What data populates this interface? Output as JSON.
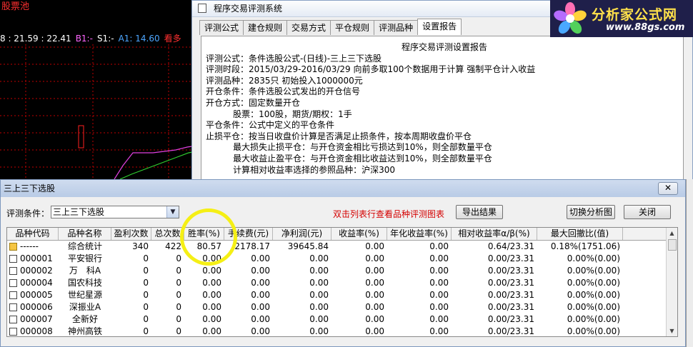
{
  "chart": {
    "title": "股票池",
    "legend": [
      {
        "text": "8 : 21.59 : 22.41",
        "color": "#ffffff"
      },
      {
        "text": "B1:-",
        "color": "#ff66ff"
      },
      {
        "text": "S1:-",
        "color": "#ffffff"
      },
      {
        "text": "A1: 14.60",
        "color": "#4da6ff"
      },
      {
        "text": "看多",
        "color": "#ff3030"
      }
    ],
    "colors": {
      "bg": "#000000",
      "magenta": "#e040e0",
      "green": "#30d030",
      "red": "#ff2020"
    }
  },
  "top_window": {
    "title": "程序交易评测系统",
    "tabs": [
      "评测公式",
      "建仓规则",
      "交易方式",
      "平仓规则",
      "评测品种",
      "设置报告"
    ],
    "active_tab": 5,
    "report": {
      "title": "程序交易评测设置报告",
      "lines": [
        "评测公式：条件选股公式-(日线)-三上三下选股",
        "评测时段：2015/03/29-2016/03/29 向前多取100个数据用于计算 强制平仓计入收益",
        "评测品种：2835只 初始投入1000000元",
        "开仓条件：条件选股公式发出的开仓信号",
        "开仓方式：固定数量开仓",
        "          股票：100股，期货/期权：1手",
        "平仓条件：公式中定义的平仓条件",
        "止损平仓：按当日收盘价计算是否满足止损条件，按本周期收盘价平仓",
        "          最大损失止损平仓：与开仓资金相比亏损达到10%，则全部数量平仓",
        "          最大收益止盈平仓：与开仓资金相比收益达到10%，则全部数量平仓",
        "          计算相对收益率选择的参照品种：沪深300"
      ]
    }
  },
  "logo": {
    "name": "分析家公式网",
    "url": "www.88gs.com"
  },
  "bottom_window": {
    "title": "三上三下选股",
    "close_symbol": "✕",
    "condition_label": "评测条件：",
    "condition_value": "三上三下选股",
    "hint": "双击列表行查看品种评测图表",
    "buttons": {
      "export": "导出结果",
      "switch": "切换分析图",
      "close": "关闭"
    },
    "columns": [
      "品种代码",
      "品种名称",
      "盈利次数",
      "总次数",
      "胜率(%)",
      "手续费(元)",
      "净利润(元)",
      "收益率(%)",
      "年化收益率(%)",
      "相对收益率α/β(%)",
      "最大回撤比(值)"
    ],
    "rows": [
      {
        "icon": "folder",
        "code": "------",
        "name": "综合统计",
        "wins": "340",
        "total": "422",
        "winrate": "80.57",
        "fee": "2178.17",
        "profit": "39645.84",
        "ret": "0.00",
        "annual": "0.00",
        "rel": "0.64/23.31",
        "dd": "0.18%(1751.06)"
      },
      {
        "icon": "doc",
        "code": "000001",
        "name": "平安银行",
        "wins": "0",
        "total": "0",
        "winrate": "0.00",
        "fee": "0.00",
        "profit": "0.00",
        "ret": "0.00",
        "annual": "0.00",
        "rel": "0.00/23.31",
        "dd": "0.00%(0.00)"
      },
      {
        "icon": "doc",
        "code": "000002",
        "name": "万　科A",
        "wins": "0",
        "total": "0",
        "winrate": "0.00",
        "fee": "0.00",
        "profit": "0.00",
        "ret": "0.00",
        "annual": "0.00",
        "rel": "0.00/23.31",
        "dd": "0.00%(0.00)"
      },
      {
        "icon": "doc",
        "code": "000004",
        "name": "国农科技",
        "wins": "0",
        "total": "0",
        "winrate": "0.00",
        "fee": "0.00",
        "profit": "0.00",
        "ret": "0.00",
        "annual": "0.00",
        "rel": "0.00/23.31",
        "dd": "0.00%(0.00)"
      },
      {
        "icon": "doc",
        "code": "000005",
        "name": "世纪星源",
        "wins": "0",
        "total": "0",
        "winrate": "0.00",
        "fee": "0.00",
        "profit": "0.00",
        "ret": "0.00",
        "annual": "0.00",
        "rel": "0.00/23.31",
        "dd": "0.00%(0.00)"
      },
      {
        "icon": "doc",
        "code": "000006",
        "name": "深振业A",
        "wins": "0",
        "total": "0",
        "winrate": "0.00",
        "fee": "0.00",
        "profit": "0.00",
        "ret": "0.00",
        "annual": "0.00",
        "rel": "0.00/23.31",
        "dd": "0.00%(0.00)"
      },
      {
        "icon": "doc",
        "code": "000007",
        "name": "全新好",
        "wins": "0",
        "total": "0",
        "winrate": "0.00",
        "fee": "0.00",
        "profit": "0.00",
        "ret": "0.00",
        "annual": "0.00",
        "rel": "0.00/23.31",
        "dd": "0.00%(0.00)"
      },
      {
        "icon": "doc",
        "code": "000008",
        "name": "神州高铁",
        "wins": "0",
        "total": "0",
        "winrate": "0.00",
        "fee": "0.00",
        "profit": "0.00",
        "ret": "0.00",
        "annual": "0.00",
        "rel": "0.00/23.31",
        "dd": "0.00%(0.00)"
      }
    ],
    "highlight_color": "#f5ef15"
  }
}
